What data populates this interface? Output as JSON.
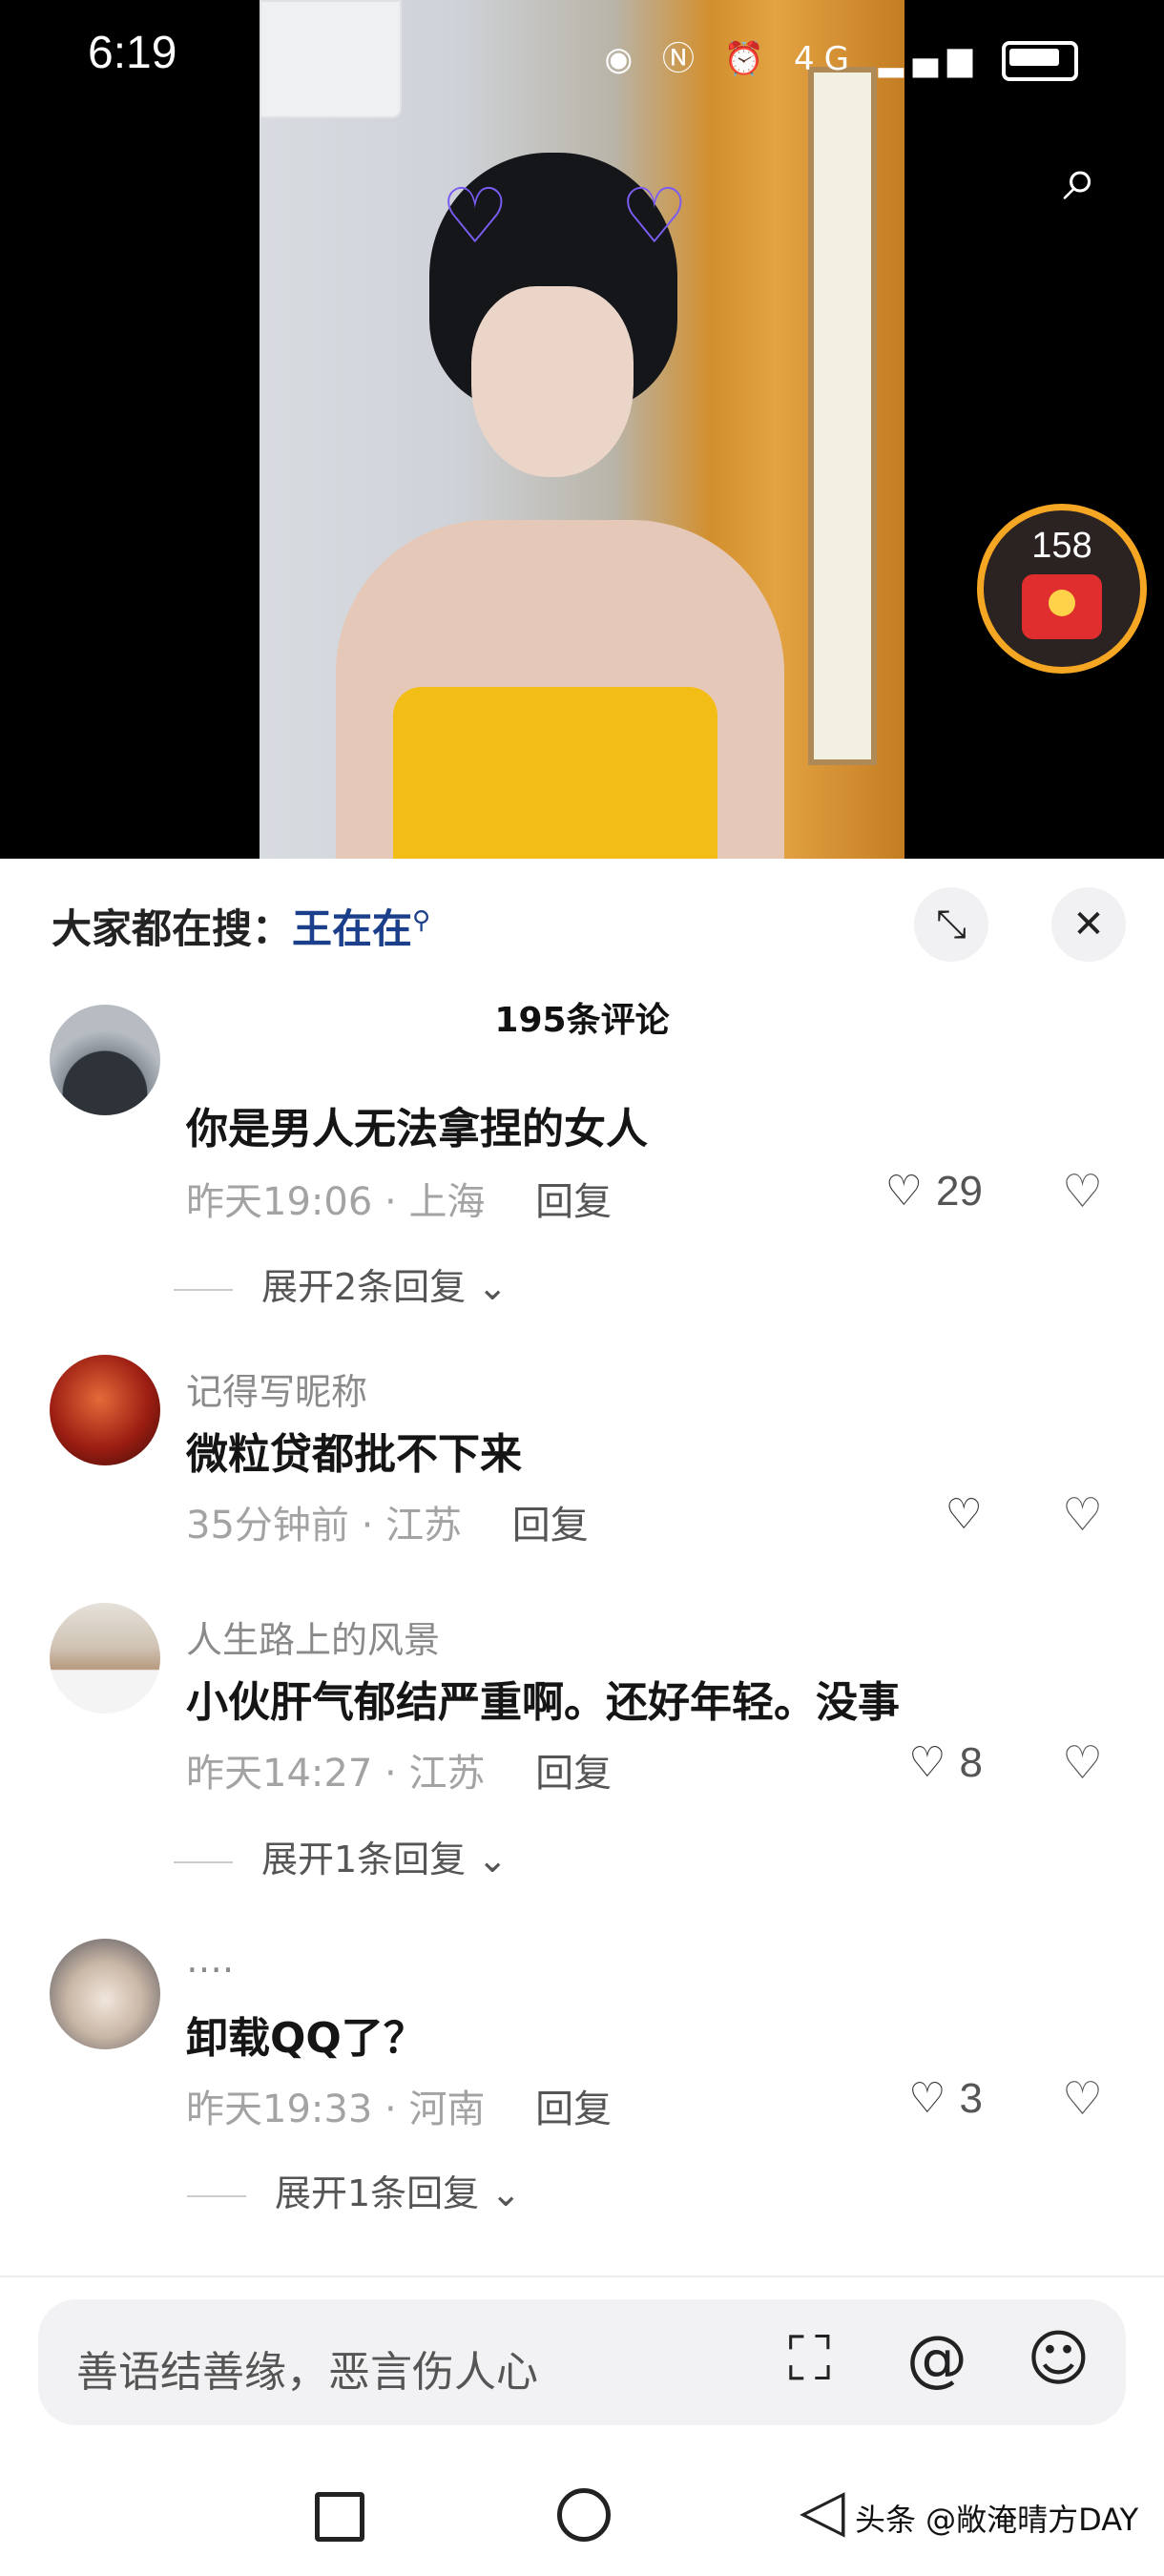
{
  "status_bar": {
    "time": "6:19",
    "network": "4G"
  },
  "video": {
    "red_packet_count": "158"
  },
  "sheet": {
    "hot_search_label": "大家都在搜：",
    "hot_search_keyword": "王在在",
    "comment_count_title": "195条评论"
  },
  "comments": [
    {
      "username": "",
      "text": "你是男人无法拿捏的女人",
      "time": "昨天19:06",
      "location": "上海",
      "reply": "回复",
      "likes": "29",
      "expand": "展开2条回复"
    },
    {
      "username": "记得写昵称",
      "text": "微粒贷都批不下来",
      "time": "35分钟前",
      "location": "江苏",
      "reply": "回复",
      "likes": "",
      "expand": ""
    },
    {
      "username": "人生路上的风景",
      "text": "小伙肝气郁结严重啊。还好年轻。没事",
      "time": "昨天14:27",
      "location": "江苏",
      "reply": "回复",
      "likes": "8",
      "expand": "展开1条回复"
    },
    {
      "username": "….",
      "text": "卸载QQ了？",
      "time": "昨天19:33",
      "location": "河南",
      "reply": "回复",
      "likes": "3",
      "expand": "展开1条回复"
    }
  ],
  "input": {
    "placeholder": "善语结善缘，恶言伤人心"
  },
  "watermark": "头条 @敞淹晴方DAY",
  "colors": {
    "accent_keyword": "#1b3f8a",
    "red_packet": "#e02e2e",
    "ring": "#f5a623"
  },
  "icons": [
    "search-icon",
    "expand-icon",
    "close-icon",
    "heart-icon",
    "broken-heart-icon",
    "image-icon",
    "at-icon",
    "emoji-icon",
    "nav-square-icon",
    "nav-home-icon",
    "nav-back-icon"
  ]
}
